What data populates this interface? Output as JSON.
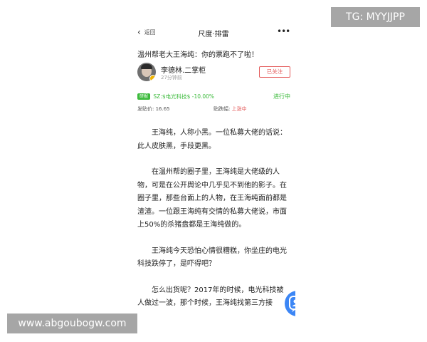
{
  "header": {
    "back_label": "返回",
    "title": "尺度·排雷",
    "more_icon": "more-dots-icon"
  },
  "article": {
    "headline": "温州帮老大王海纯：你的票跑不了啦！",
    "author": {
      "name": "李德林.二掌柜",
      "time": "27分钟前",
      "follow_label": "已关注"
    },
    "stock_tag": {
      "chip": "研报",
      "text": "SZ:$电光科技$ -10.00%",
      "status": "进行中"
    },
    "meta": {
      "post_price": "发贴价: 16.65",
      "fall_label": "贴跌幅: ",
      "fall_value": "上涨中"
    },
    "paragraphs": [
      "王海纯，人称小黑。一位私募大佬的话说：此人皮肤黑，手段更黑。",
      "在温州帮的圈子里，王海纯是大佬级的人物，可是在公开舆论中几乎见不到他的影子。在圈子里，那些台面上的人物，在王海纯面前都是渣渣。一位跟王海纯有交情的私募大佬说，市面上50%的杀猪盘都是王海纯做的。",
      "王海纯今天恐怕心情很糟糕，你坐庄的电光科技跌停了，是吓得吧？",
      "怎么出货呢？2017年的时候，电光科技被人做过一波，那个时候，王海纯找第三方接"
    ]
  },
  "fab_icon": "chat-users-icon",
  "watermarks": {
    "top_right": "TG: MYYJJPP",
    "bottom_left": "www.abgoubogw.com"
  },
  "colors": {
    "accent_red": "#e35a5a",
    "accent_green": "#3dbb3d",
    "fab_blue": "#3c86f5"
  }
}
